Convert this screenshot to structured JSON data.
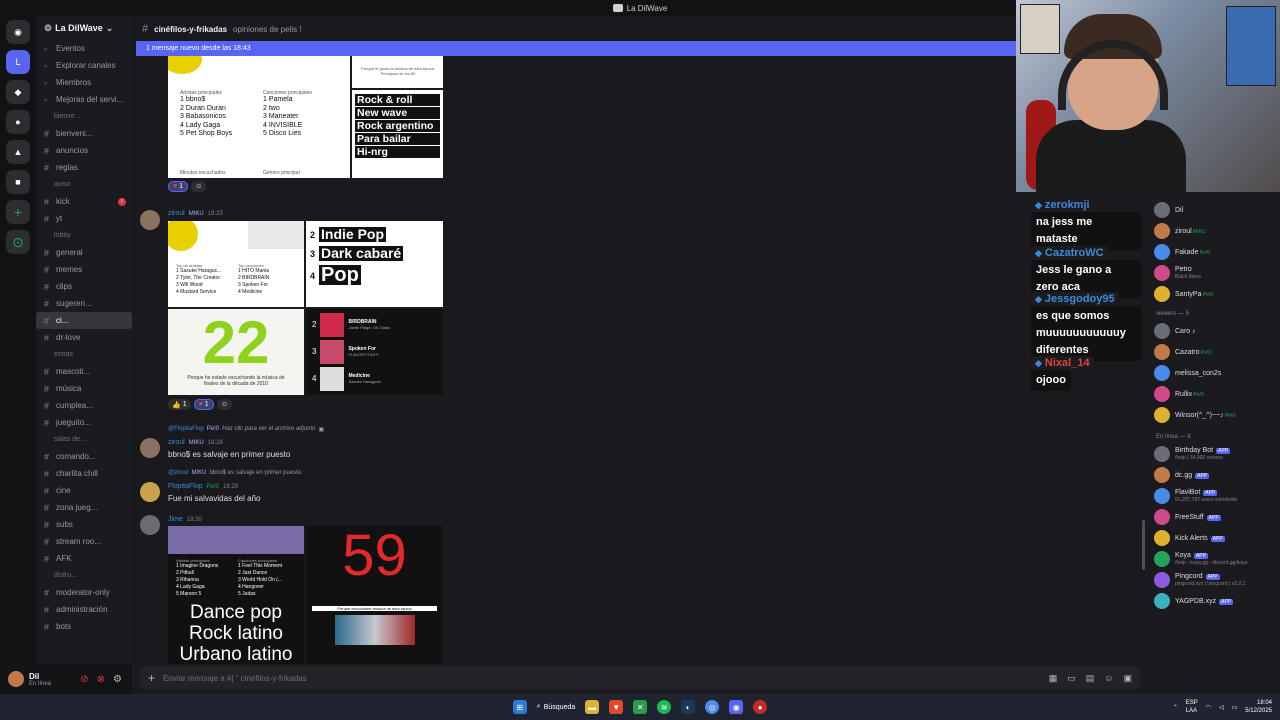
{
  "window": {
    "title": "La DilWave"
  },
  "server": {
    "name": "La DilWave"
  },
  "channels": [
    {
      "type": "item",
      "label": "Eventos"
    },
    {
      "type": "item",
      "label": "Explorar canales"
    },
    {
      "type": "item",
      "label": "Miembros"
    },
    {
      "type": "item",
      "label": "Mejoras del servi..."
    },
    {
      "type": "cat",
      "label": "bienve..."
    },
    {
      "type": "chan",
      "label": "bienveni..."
    },
    {
      "type": "chan",
      "label": "anuncios"
    },
    {
      "type": "chan",
      "label": "reglas"
    },
    {
      "type": "cat",
      "label": "aviso"
    },
    {
      "type": "chan",
      "label": "kick",
      "badge": "!"
    },
    {
      "type": "chan",
      "label": "yt"
    },
    {
      "type": "cat",
      "label": "lobby"
    },
    {
      "type": "chan",
      "label": "general"
    },
    {
      "type": "chan",
      "label": "memes"
    },
    {
      "type": "chan",
      "label": "clips"
    },
    {
      "type": "chan",
      "label": "sugeren..."
    },
    {
      "type": "active",
      "label": "ci..."
    },
    {
      "type": "chan",
      "label": "dr-love"
    },
    {
      "type": "cat",
      "label": "extras"
    },
    {
      "type": "chan",
      "label": "mascoti..."
    },
    {
      "type": "chan",
      "label": "música"
    },
    {
      "type": "chan",
      "label": "cumplea..."
    },
    {
      "type": "chan",
      "label": "jueguito..."
    },
    {
      "type": "cat",
      "label": "salas de ..."
    },
    {
      "type": "chan",
      "label": "comando..."
    },
    {
      "type": "chan",
      "label": "charlita chill"
    },
    {
      "type": "chan",
      "label": "cine"
    },
    {
      "type": "chan",
      "label": "zona jueg..."
    },
    {
      "type": "chan",
      "label": "subs"
    },
    {
      "type": "chan",
      "label": "stream roo..."
    },
    {
      "type": "chan",
      "label": "AFK"
    },
    {
      "type": "cat",
      "label": "disfru..."
    },
    {
      "type": "chan",
      "label": "moderator-only"
    },
    {
      "type": "chan",
      "label": "administración"
    },
    {
      "type": "chan",
      "label": "bots"
    }
  ],
  "user": {
    "name": "Dil",
    "status": "En línea"
  },
  "header": {
    "channel": "cinéfilos-y-frikadas",
    "topic": "opiniones de pelis !"
  },
  "newbar": "1 mensaje nuevo desde las 18:43",
  "card1": {
    "artists_title": "Artistas principales",
    "songs_title": "Canciones principales",
    "artists": [
      "1  bbno$",
      "2  Duran Duran",
      "3  Babasonicos",
      "4  Lady Gaga",
      "5  Pet Shop Boys"
    ],
    "songs": [
      "1  Pamela",
      "2  two",
      "3  Maneater",
      "4  INVISIBLE",
      "5  Disco Lies"
    ],
    "footer_left": "Minutos escuchados",
    "footer_right": "Género principal",
    "top_right": "Porque te gustó la música de esta época. Principios de los 80",
    "genres": [
      "Rock & roll",
      "New wave",
      "Rock argentino",
      "Para bailar",
      "Hi-nrg"
    ]
  },
  "react1": {
    "heart": "1"
  },
  "msg2": {
    "author": "ziroul",
    "tag": "MIKU",
    "time": "18:23"
  },
  "card2": {
    "artists_title": "Top de artistas",
    "songs_title": "Top canciones",
    "artists": [
      "1  Sasuke Haraguc...",
      "2  Tyler, The Creator",
      "3  Will Wood",
      "4  Mustard Service"
    ],
    "songs": [
      "1  HITO Mania",
      "2  BIRDBRAIN",
      "3  Spoken For",
      "4  Medicine"
    ],
    "genres": [
      {
        "n": "2",
        "g": "Indie Pop"
      },
      {
        "n": "3",
        "g": "Dark cabaré"
      },
      {
        "n": "4",
        "g": "Pop"
      }
    ],
    "number": "22",
    "number_caption": "Porque he estado escuchando la música de finales de la década de 2010",
    "tracks": [
      {
        "n": "2",
        "t": "BIRDBRAIN",
        "a": "Jamie Paige, OK Glass"
      },
      {
        "n": "3",
        "t": "Spoken For",
        "a": "FLAVOR FOLEY"
      },
      {
        "n": "4",
        "t": "Medicine",
        "a": "Sasuke Haraguchi"
      }
    ]
  },
  "react2": {
    "thumbs": "1",
    "heart": "1"
  },
  "msg3": {
    "reply_user": "@FlopitaFlop",
    "reply_tag": "Pe!0",
    "reply_text": "Haz clic para ver el archivo adjunto",
    "author": "ziroul",
    "tag": "MIKU",
    "time": "18:28",
    "text": "bbno$ es salvaje en primer puesto"
  },
  "msg4": {
    "reply_user": "@ziroul",
    "reply_tag": "MIKU",
    "reply_text": "bbno$ es salvaje en primer puesto",
    "author": "FlopitaFlop",
    "tag": "Pe!0",
    "time": "18:29",
    "text": "Fue mi salvavidas del año"
  },
  "msg5": {
    "author": "Jime",
    "time": "18:30"
  },
  "card3": {
    "artists_title": "Artistas principales",
    "songs_title": "Canciones principales",
    "artists": [
      "1  Imagine Dragons",
      "2  Pitbull",
      "3  Rihanna",
      "4  Lady Gaga",
      "5  Maroon 5"
    ],
    "songs": [
      "1  Feel This Moment",
      "2  Just Dance",
      "3  World Hold On (...",
      "4  Hangover",
      "5  Judas"
    ],
    "genres": [
      "Dance pop",
      "Rock latino",
      "Urbano latino"
    ],
    "number": "59",
    "number_caption": "Porque escuchaste música de esta época"
  },
  "input": {
    "placeholder": "Enviar mensaje a #| ˚ cinéfilos-y-frikadas"
  },
  "chat": [
    {
      "user": "zerokmji",
      "text": "na jess me mataste",
      "color": "#3b8ad8"
    },
    {
      "user": "CazatroWC",
      "text": "Jess le gano a zero aca",
      "color": "#3b8ad8"
    },
    {
      "user": "Jessgodoy95",
      "text": "es que somos muuuuuuuuuuuy diferentes",
      "color": "#3b8ad8"
    },
    {
      "user": "Nixal_14",
      "text": "ojooo",
      "color": "#e0413b"
    }
  ],
  "members": {
    "top": [
      {
        "name": "Dil",
        "tag": ""
      },
      {
        "name": "ziroul",
        "tag": "MIKU"
      },
      {
        "name": "Fakade",
        "tag": "Pe!0"
      },
      {
        "name": "Petro",
        "sub": "Black Mesa"
      },
      {
        "name": "SantyPa",
        "tag": "Pe!0"
      }
    ],
    "viewers_header": "viewers — 5",
    "viewers": [
      {
        "name": "Caro ♪",
        "tag": ""
      },
      {
        "name": "Cazatro",
        "tag": "Pe!0"
      },
      {
        "name": "melissa_con2s",
        "tag": ""
      },
      {
        "name": "Rullix",
        "tag": "Pe!0"
      },
      {
        "name": "Winsor(^_^)~~♪",
        "tag": "Pe!0"
      }
    ],
    "online_header": "En línea — 8",
    "online": [
      {
        "name": "Birthday Bot",
        "app": "APP",
        "sub": "/help | 34,992 servers"
      },
      {
        "name": "dc.gg",
        "app": "APP",
        "sub": ""
      },
      {
        "name": "FlaviBot",
        "app": "APP",
        "sub": "91,207,797 users worldwide"
      },
      {
        "name": "FreeStuff",
        "app": "APP",
        "sub": ""
      },
      {
        "name": "Kick Alerts",
        "app": "APP",
        "sub": ""
      },
      {
        "name": "Koya",
        "app": "APP",
        "sub": "/help - koya.gg - discord.gg/koya"
      },
      {
        "name": "Pingcord",
        "app": "APP",
        "sub": "pingcord.xyz | !pingcord | v2.2.1"
      },
      {
        "name": "YAGPDB.xyz",
        "app": "APP",
        "sub": ""
      }
    ]
  },
  "taskbar": {
    "search": "Búsqueda",
    "lang": "ESP",
    "region": "LAA",
    "time": "18:04",
    "date": "5/12/2025"
  }
}
